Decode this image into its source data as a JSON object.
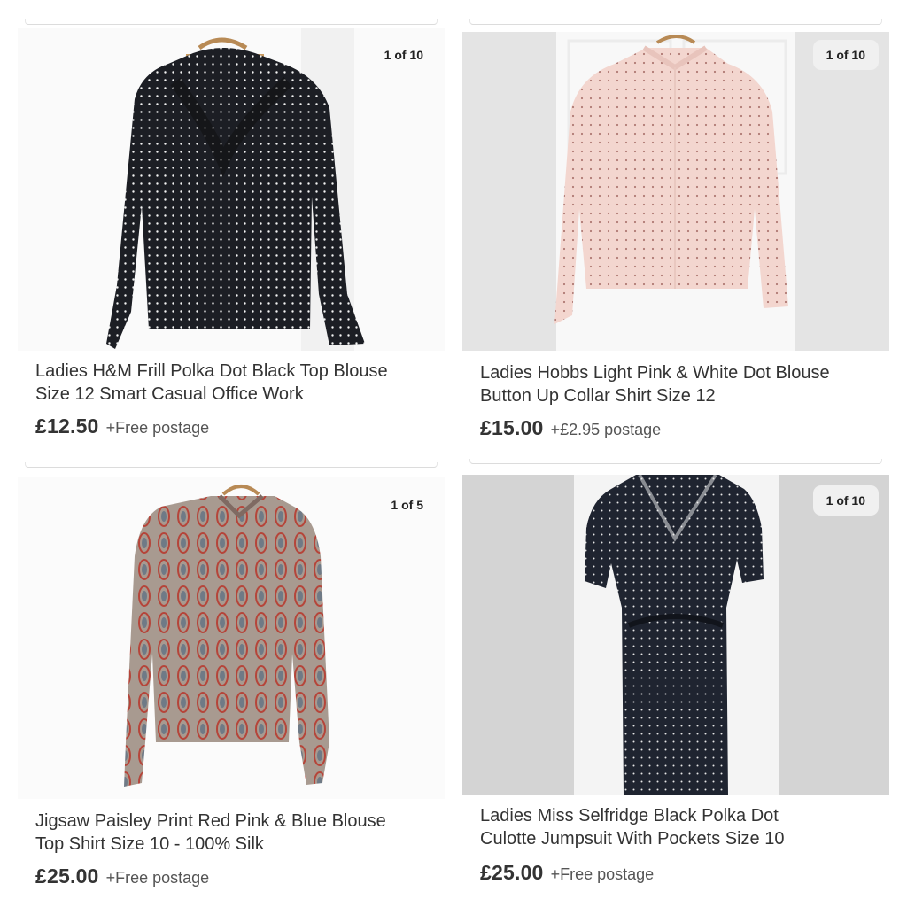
{
  "listings": [
    {
      "image_counter": "1 of 10",
      "title_line1": "Ladies H&M Frill Polka Dot Black Top Blouse",
      "title_line2": "Size 12 Smart Casual Office Work",
      "price": "£12.50",
      "postage": "+Free postage",
      "garment_color": "#1c1e24",
      "dot_color": "#f4f4f4"
    },
    {
      "image_counter": "1 of 10",
      "title_line1": "Ladies Hobbs Light Pink & White Dot Blouse",
      "title_line2": "Button Up Collar Shirt Size 12",
      "price": "£15.00",
      "postage": "+£2.95 postage",
      "garment_color": "#f3d6cf",
      "dot_color": "#b07a74"
    },
    {
      "image_counter": "1 of 5",
      "title_line1": "Jigsaw Paisley Print Red Pink & Blue Blouse",
      "title_line2": "Top Shirt Size 10 - 100% Silk",
      "price": "£25.00",
      "postage": "+Free postage",
      "garment_color": "#a08a80",
      "dot_color": "#b5453a"
    },
    {
      "image_counter": "1 of 10",
      "title_line1": "Ladies Miss Selfridge Black Polka Dot",
      "title_line2": "Culotte Jumpsuit With Pockets Size 10",
      "price": "£25.00",
      "postage": "+Free postage",
      "garment_color": "#1f2430",
      "dot_color": "#e6e6e6"
    }
  ]
}
